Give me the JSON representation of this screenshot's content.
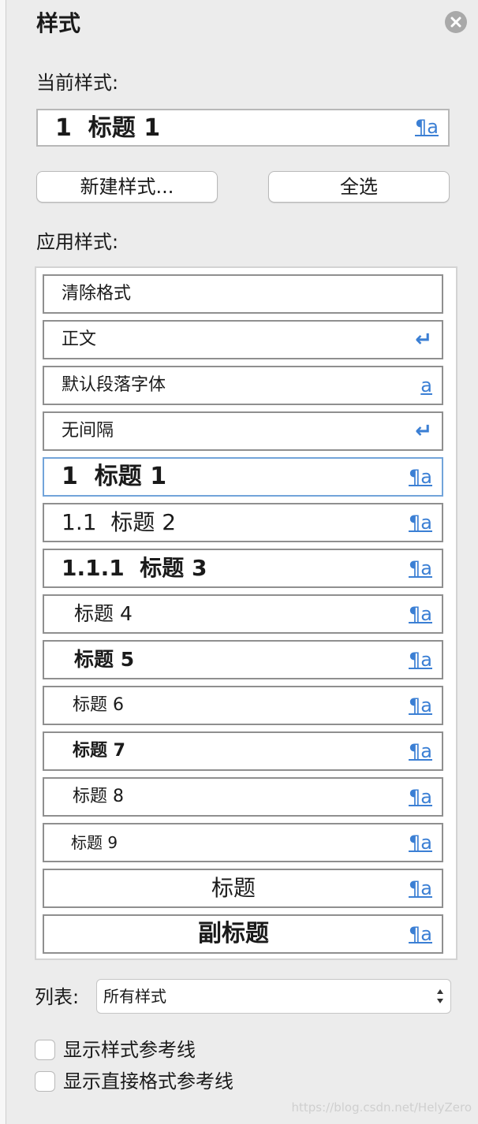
{
  "panel": {
    "title": "样式",
    "close_icon": "close-icon"
  },
  "current_style": {
    "label": "当前样式:",
    "value": "1  标题 1",
    "type_mark": "¶a"
  },
  "buttons": {
    "new_style": "新建样式...",
    "select_all": "全选"
  },
  "apply_styles": {
    "label": "应用样式:",
    "items": [
      {
        "label": "清除格式",
        "mark": ""
      },
      {
        "label": "正文",
        "mark": "↵"
      },
      {
        "label": "默认段落字体",
        "mark": "a"
      },
      {
        "label": "无间隔",
        "mark": "↵"
      },
      {
        "label": "1  标题 1",
        "mark": "¶a"
      },
      {
        "label": "1.1  标题 2",
        "mark": "¶a"
      },
      {
        "label": "1.1.1  标题 3",
        "mark": "¶a"
      },
      {
        "label": "标题 4",
        "mark": "¶a"
      },
      {
        "label": "标题 5",
        "mark": "¶a"
      },
      {
        "label": "标题 6",
        "mark": "¶a"
      },
      {
        "label": "标题 7",
        "mark": "¶a"
      },
      {
        "label": "标题 8",
        "mark": "¶a"
      },
      {
        "label": "标题 9",
        "mark": "¶a"
      },
      {
        "label": "标题",
        "mark": "¶a"
      },
      {
        "label": "副标题",
        "mark": "¶a"
      }
    ],
    "selected": "1  标题 1"
  },
  "list_filter": {
    "label": "列表:",
    "value": "所有样式"
  },
  "options": {
    "show_style_guides": "显示样式参考线",
    "show_direct_format_guides": "显示直接格式参考线"
  },
  "watermark": "https://blog.csdn.net/HelyZero",
  "colors": {
    "panel_bg": "#ececec",
    "link_blue": "#3b7fd4",
    "selected_border": "#72a4da"
  }
}
